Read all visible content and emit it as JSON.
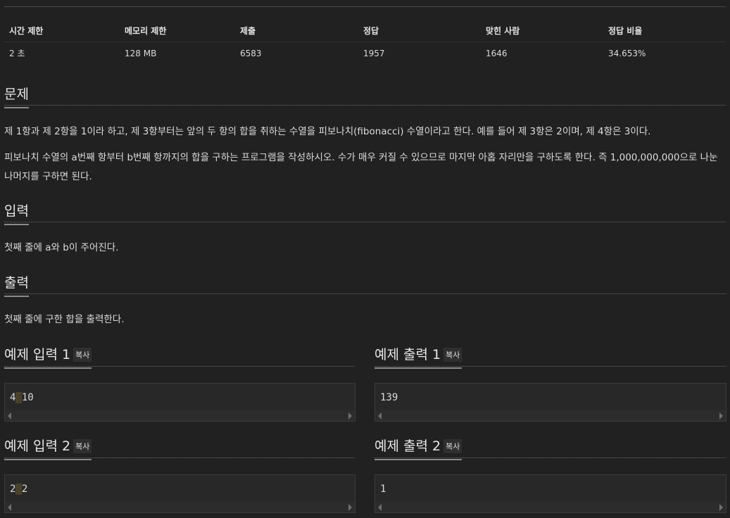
{
  "stats": {
    "headers": [
      "시간 제한",
      "메모리 제한",
      "제출",
      "정답",
      "맞힌 사람",
      "정답 비율"
    ],
    "values": [
      "2 초",
      "128 MB",
      "6583",
      "1957",
      "1646",
      "34.653%"
    ]
  },
  "problem": {
    "title": "문제",
    "p1": "제 1항과 제 2항을 1이라 하고, 제 3항부터는 앞의 두 항의 합을 취하는 수열을 피보나치(fibonacci) 수열이라고 한다. 예를 들어 제 3항은 2이며, 제 4항은 3이다.",
    "p2": "피보나치 수열의 a번째 항부터 b번째 항까지의 합을 구하는 프로그램을 작성하시오. 수가 매우 커질 수 있으므로 마지막 아홉 자리만을 구하도록 한다. 즉 1,000,000,000으로 나눈 나머지를 구하면 된다."
  },
  "input": {
    "title": "입력",
    "text": "첫째 줄에 a와 b이 주어진다."
  },
  "output": {
    "title": "출력",
    "text": "첫째 줄에 구한 합을 출력한다."
  },
  "copy_label": "복사",
  "samples": [
    {
      "input_title": "예제 입력 1",
      "input_a": "4",
      "input_b": "10",
      "output_title": "예제 출력 1",
      "output": "139"
    },
    {
      "input_title": "예제 입력 2",
      "input_a": "2",
      "input_b": "2",
      "output_title": "예제 출력 2",
      "output": "1"
    }
  ]
}
